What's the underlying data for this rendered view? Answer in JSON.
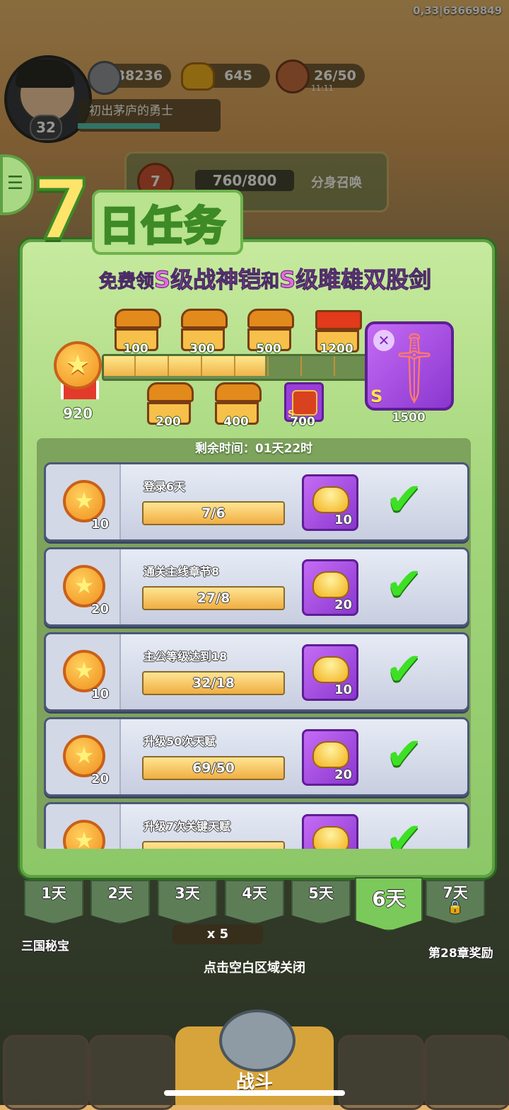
{
  "debug_text": "0,33|63669849",
  "player": {
    "level": "32",
    "title": "初出茅庐的勇士"
  },
  "resources": {
    "silver": "38236",
    "gold": "645",
    "stamina": "26/50",
    "stamina_timer": "11:11"
  },
  "background": {
    "summon_level": "7",
    "summon_progress": "760/800",
    "summon_label": "分身召唤",
    "left_caption": "三国秘宝",
    "right_caption": "第28章奖励",
    "cost_label": "x 5"
  },
  "panel": {
    "title_number": "7",
    "title_text": "日任务",
    "subtitle_pre": "免费领",
    "subtitle_item1": "S级战神铠",
    "subtitle_mid": "和",
    "subtitle_item2": "S级雎雄双股剑",
    "points_total": "920",
    "points_progress": 0.62,
    "milestones_top": [
      "100",
      "300",
      "500",
      "1200"
    ],
    "milestones_bottom": [
      "200",
      "400",
      "700"
    ],
    "final_reward_points": "1500",
    "final_reward_grade": "S",
    "small_reward_grade": "S",
    "timer_text": "剩余时间：01天22时"
  },
  "tasks": [
    {
      "name": "登录6天",
      "points": "10",
      "progress": "7/6",
      "reward": "10"
    },
    {
      "name": "通关主线章节8",
      "points": "20",
      "progress": "27/8",
      "reward": "20"
    },
    {
      "name": "主公等级达到18",
      "points": "10",
      "progress": "32/18",
      "reward": "10"
    },
    {
      "name": "升级50次天赋",
      "points": "20",
      "progress": "69/50",
      "reward": "20"
    },
    {
      "name": "升级7次关键天赋",
      "points": "",
      "progress": "",
      "reward": ""
    }
  ],
  "tabs": [
    "1天",
    "2天",
    "3天",
    "4天",
    "5天",
    "6天",
    "7天"
  ],
  "active_tab": "6天",
  "close_hint": "点击空白区域关闭",
  "bottom_nav": {
    "battle_label": "战斗"
  }
}
